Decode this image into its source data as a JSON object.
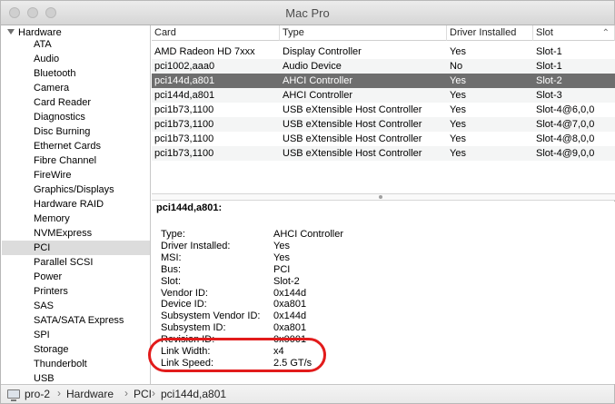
{
  "window": {
    "title": "Mac Pro"
  },
  "sidebar": {
    "group_label": "Hardware",
    "items": [
      "ATA",
      "Audio",
      "Bluetooth",
      "Camera",
      "Card Reader",
      "Diagnostics",
      "Disc Burning",
      "Ethernet Cards",
      "Fibre Channel",
      "FireWire",
      "Graphics/Displays",
      "Hardware RAID",
      "Memory",
      "NVMExpress",
      "PCI",
      "Parallel SCSI",
      "Power",
      "Printers",
      "SAS",
      "SATA/SATA Express",
      "SPI",
      "Storage",
      "Thunderbolt",
      "USB"
    ],
    "selected": "PCI"
  },
  "table": {
    "columns": [
      "Card",
      "Type",
      "Driver Installed",
      "Slot"
    ],
    "rows": [
      [
        "AMD Radeon HD 7xxx",
        "Display Controller",
        "Yes",
        "Slot-1"
      ],
      [
        "pci1002,aaa0",
        "Audio Device",
        "No",
        "Slot-1"
      ],
      [
        "pci144d,a801",
        "AHCI Controller",
        "Yes",
        "Slot-2"
      ],
      [
        "pci144d,a801",
        "AHCI Controller",
        "Yes",
        "Slot-3"
      ],
      [
        "pci1b73,1100",
        "USB eXtensible Host Controller",
        "Yes",
        "Slot-4@6,0,0"
      ],
      [
        "pci1b73,1100",
        "USB eXtensible Host Controller",
        "Yes",
        "Slot-4@7,0,0"
      ],
      [
        "pci1b73,1100",
        "USB eXtensible Host Controller",
        "Yes",
        "Slot-4@8,0,0"
      ],
      [
        "pci1b73,1100",
        "USB eXtensible Host Controller",
        "Yes",
        "Slot-4@9,0,0"
      ]
    ],
    "selected_row": 2
  },
  "detail": {
    "heading": "pci144d,a801:",
    "fields": [
      [
        "Type:",
        "AHCI Controller"
      ],
      [
        "Driver Installed:",
        "Yes"
      ],
      [
        "MSI:",
        "Yes"
      ],
      [
        "Bus:",
        "PCI"
      ],
      [
        "Slot:",
        "Slot-2"
      ],
      [
        "Vendor ID:",
        "0x144d"
      ],
      [
        "Device ID:",
        "0xa801"
      ],
      [
        "Subsystem Vendor ID:",
        "0x144d"
      ],
      [
        "Subsystem ID:",
        "0xa801"
      ],
      [
        "Revision ID:",
        "0x0001"
      ],
      [
        "Link Width:",
        "x4"
      ],
      [
        "Link Speed:",
        "2.5 GT/s"
      ]
    ]
  },
  "pathbar": {
    "crumbs": [
      "pro-2",
      "Hardware",
      "PCI",
      "pci144d,a801"
    ],
    "separator": "›"
  },
  "colors": {
    "annotation": "#e21b1b",
    "selection": "#6e6e6e",
    "sidebar_selection": "#dcdcdc"
  }
}
